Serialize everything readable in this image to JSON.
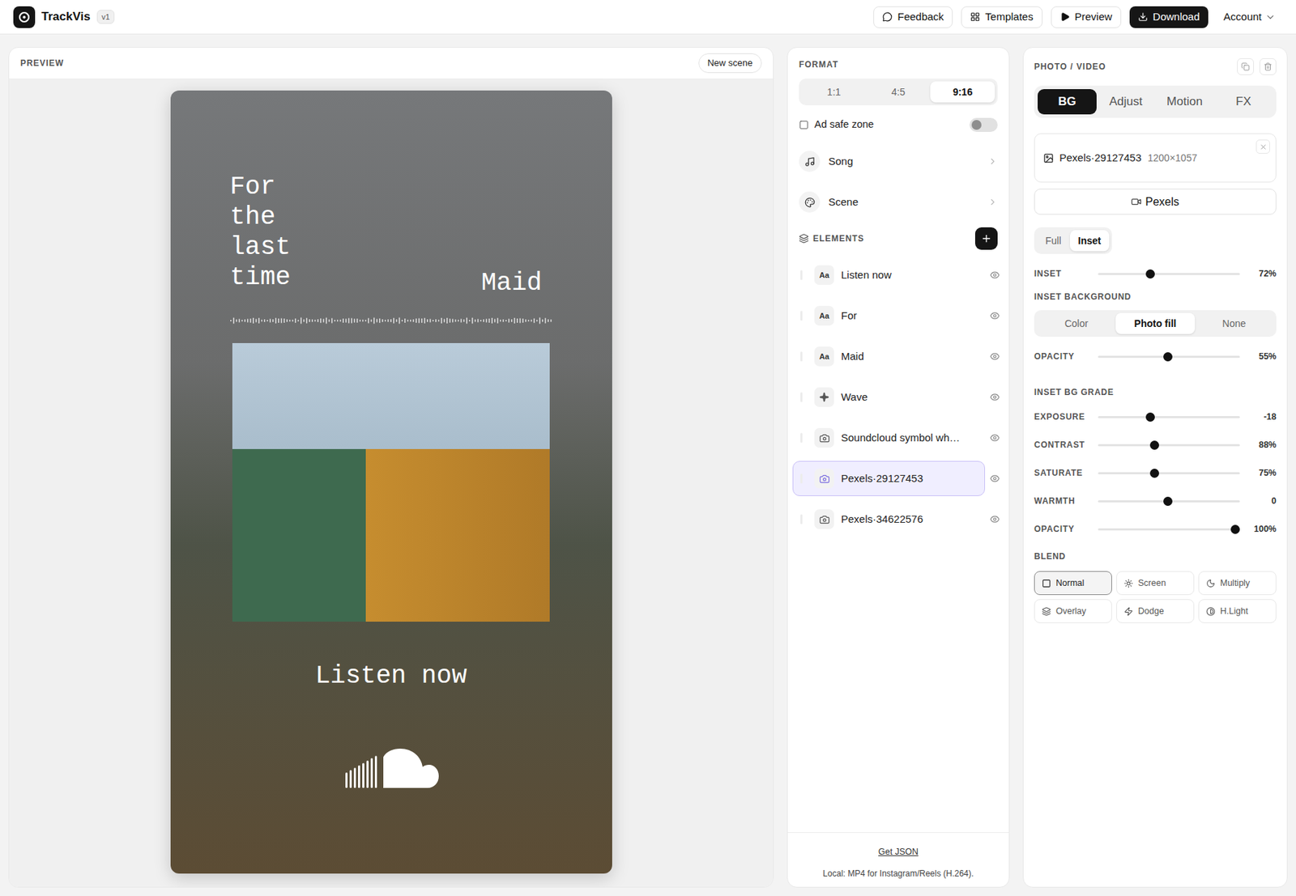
{
  "app": {
    "name": "TrackVis",
    "version": "v1"
  },
  "toolbar": [
    {
      "label": "Feedback",
      "kind": "outline"
    },
    {
      "label": "Templates",
      "kind": "outline"
    },
    {
      "label": "Preview",
      "kind": "outline"
    },
    {
      "label": "Download",
      "kind": "primary"
    },
    {
      "label": "Account",
      "kind": "menu"
    }
  ],
  "preview": {
    "title": "PREVIEW",
    "new_scene": "New scene",
    "canvas": {
      "title_text": "For the last time",
      "artist": "Maid",
      "cta": "Listen now"
    }
  },
  "format": {
    "title": "FORMAT",
    "ratios": [
      {
        "label": "1:1",
        "selected": false
      },
      {
        "label": "4:5",
        "selected": false
      },
      {
        "label": "9:16",
        "selected": true
      }
    ],
    "ad_safe_zone": {
      "label": "Ad safe zone",
      "on": false
    },
    "rows": [
      {
        "label": "Song"
      },
      {
        "label": "Scene"
      }
    ],
    "elements_title": "ELEMENTS",
    "elements": [
      {
        "label": "Listen now",
        "kind": "text",
        "badge": "Aa",
        "selected": false,
        "visible": true
      },
      {
        "label": "For",
        "kind": "text",
        "badge": "Aa",
        "selected": false,
        "visible": true
      },
      {
        "label": "Maid",
        "kind": "text",
        "badge": "Aa",
        "selected": false,
        "visible": true
      },
      {
        "label": "Wave",
        "kind": "shape",
        "badge": "",
        "selected": false,
        "visible": true
      },
      {
        "label": "Soundcloud symbol wh…",
        "kind": "image",
        "badge": "",
        "selected": false,
        "visible": true
      },
      {
        "label": "Pexels·29127453",
        "kind": "image",
        "badge": "",
        "selected": true,
        "visible": true
      },
      {
        "label": "Pexels·34622576",
        "kind": "image",
        "badge": "",
        "selected": false,
        "visible": true
      }
    ],
    "footer": {
      "link": "Get JSON",
      "note": "Local: MP4 for Instagram/Reels (H.264)."
    }
  },
  "photo_video": {
    "title": "PHOTO / VIDEO",
    "tabs": [
      {
        "label": "BG",
        "selected": true
      },
      {
        "label": "Adjust",
        "selected": false
      },
      {
        "label": "Motion",
        "selected": false
      },
      {
        "label": "FX",
        "selected": false
      }
    ],
    "source": {
      "name": "Pexels·29127453",
      "size": "1200×1057"
    },
    "source_button": "Pexels",
    "mode": [
      {
        "label": "Full",
        "selected": false
      },
      {
        "label": "Inset",
        "selected": true
      }
    ],
    "inset": {
      "label": "INSET",
      "level": 0.36,
      "reading": "72%"
    },
    "inset_background": {
      "title": "INSET BACKGROUND",
      "options": [
        {
          "label": "Color",
          "selected": false
        },
        {
          "label": "Photo fill",
          "selected": true
        },
        {
          "label": "None",
          "selected": false
        }
      ],
      "opacity": {
        "label": "OPACITY",
        "level": 0.49,
        "reading": "55%"
      }
    },
    "grade": {
      "title": "INSET BG GRADE",
      "sliders": [
        {
          "label": "EXPOSURE",
          "level": 0.36,
          "reading": "-18"
        },
        {
          "label": "CONTRAST",
          "level": 0.39,
          "reading": "88%"
        },
        {
          "label": "SATURATE",
          "level": 0.39,
          "reading": "75%"
        },
        {
          "label": "WARMTH",
          "level": 0.49,
          "reading": "0"
        },
        {
          "label": "OPACITY",
          "level": 1,
          "reading": "100%"
        }
      ]
    },
    "blend": {
      "title": "BLEND",
      "options": [
        {
          "label": "Normal",
          "selected": true
        },
        {
          "label": "Screen",
          "selected": false
        },
        {
          "label": "Multiply",
          "selected": false
        },
        {
          "label": "Overlay",
          "selected": false
        },
        {
          "label": "Dodge",
          "selected": false
        },
        {
          "label": "H.Light",
          "selected": false
        }
      ]
    }
  }
}
